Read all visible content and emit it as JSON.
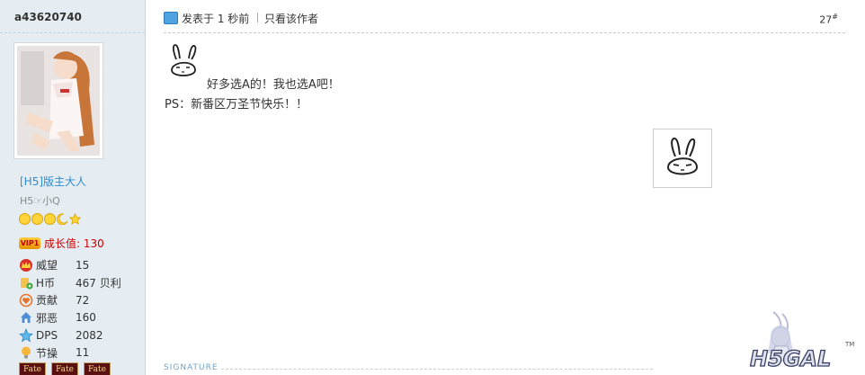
{
  "user": {
    "name": "a43620740",
    "rank": "[H5]版主大人",
    "subtitle": "H5☞小Q",
    "vip_badge": "VIP1",
    "growth_label": "成长值: 130",
    "stats": [
      {
        "icon": "crown-icon",
        "label": "威望",
        "value": "15"
      },
      {
        "icon": "coin-icon",
        "label": "H币",
        "value": "467 贝利"
      },
      {
        "icon": "heart-icon",
        "label": "贡献",
        "value": "72"
      },
      {
        "icon": "house-icon",
        "label": "邪恶",
        "value": "160"
      },
      {
        "icon": "star-icon",
        "label": "DPS",
        "value": "2082"
      },
      {
        "icon": "bulb-icon",
        "label": "节操",
        "value": "11"
      }
    ],
    "medals": [
      "Fate",
      "Fate",
      "Fate"
    ]
  },
  "post": {
    "time_text": "发表于 1 秒前",
    "author_only": "只看该作者",
    "floor": "27",
    "floor_suffix": "#",
    "line1": "好多选A的！我也选A吧！",
    "line2": "PS：新番区万圣节快乐！！",
    "signature_label": "SIGNATURE"
  },
  "logo": {
    "text": "H5GAL",
    "tm": "TM"
  }
}
